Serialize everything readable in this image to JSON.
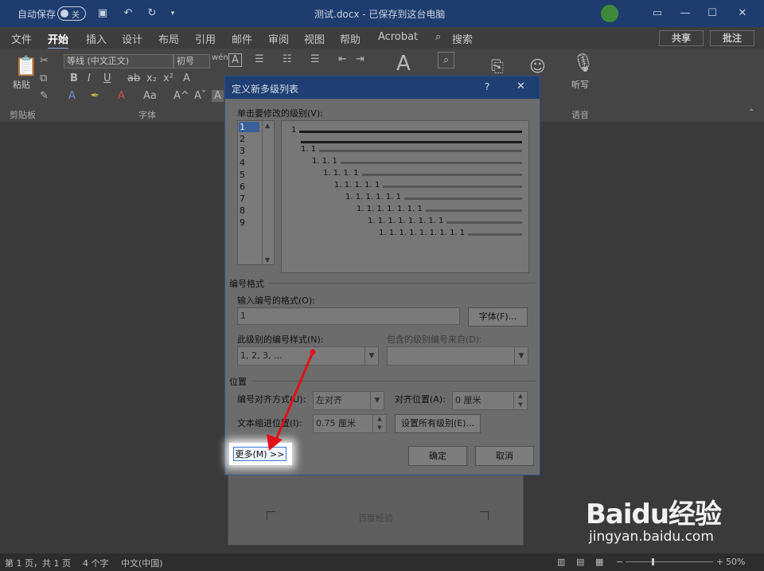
{
  "titlebar": {
    "autosave_label": "自动保存",
    "autosave_state": "关",
    "document_title": "测试.docx - 已保存到这台电脑"
  },
  "tabs": [
    "文件",
    "开始",
    "插入",
    "设计",
    "布局",
    "引用",
    "邮件",
    "审阅",
    "视图",
    "帮助",
    "Acrobat"
  ],
  "search": {
    "label": "搜索"
  },
  "header_buttons": {
    "share": "共享",
    "comment": "批注"
  },
  "ribbon": {
    "paste_label": "粘贴",
    "font_name": "等线 (中文正文)",
    "font_size": "初号",
    "group_clipboard": "剪贴板",
    "group_font": "字体",
    "dictate_label": "听写",
    "group_voice": "语音"
  },
  "dialog": {
    "title": "定义新多级列表",
    "help": "?",
    "level_prompt": "单击要修改的级别(V):",
    "levels": [
      "1",
      "2",
      "3",
      "4",
      "5",
      "6",
      "7",
      "8",
      "9"
    ],
    "preview_numbers": [
      "1",
      "1. 1",
      "1. 1. 1",
      "1. 1. 1. 1",
      "1. 1. 1. 1. 1",
      "1. 1. 1. 1. 1. 1",
      "1. 1. 1. 1. 1. 1. 1",
      "1. 1. 1. 1. 1. 1. 1. 1",
      "1. 1. 1. 1. 1. 1. 1. 1. 1"
    ],
    "numbering_format_heading": "编号格式",
    "format_input_label": "输入编号的格式(O):",
    "format_input_value": "1",
    "font_button": "字体(F)...",
    "style_label": "此级别的编号样式(N):",
    "style_value": "1, 2, 3, ...",
    "include_label": "包含的级别编号来自(D):",
    "position_heading": "位置",
    "alignment_label": "编号对齐方式(U):",
    "alignment_value": "左对齐",
    "align_at_label": "对齐位置(A):",
    "align_at_value": "0 厘米",
    "indent_label": "文本缩进位置(I):",
    "indent_value": "0.75 厘米",
    "set_all_button": "设置所有级别(E)...",
    "more_button": "更多(M) >>",
    "ok_button": "确定",
    "cancel_button": "取消"
  },
  "document": {
    "text": "百度经验"
  },
  "statusbar": {
    "page": "第 1 页，共 1 页",
    "words": "4 个字",
    "language": "中文(中国)",
    "zoom": "50%"
  },
  "watermark": {
    "brand": "Baidu经验",
    "url": "jingyan.baidu.com"
  },
  "colors": {
    "annotation_arrow": "#e0121a",
    "dialog_title": "#1f3f73",
    "titlebar": "#1e3c6e"
  }
}
